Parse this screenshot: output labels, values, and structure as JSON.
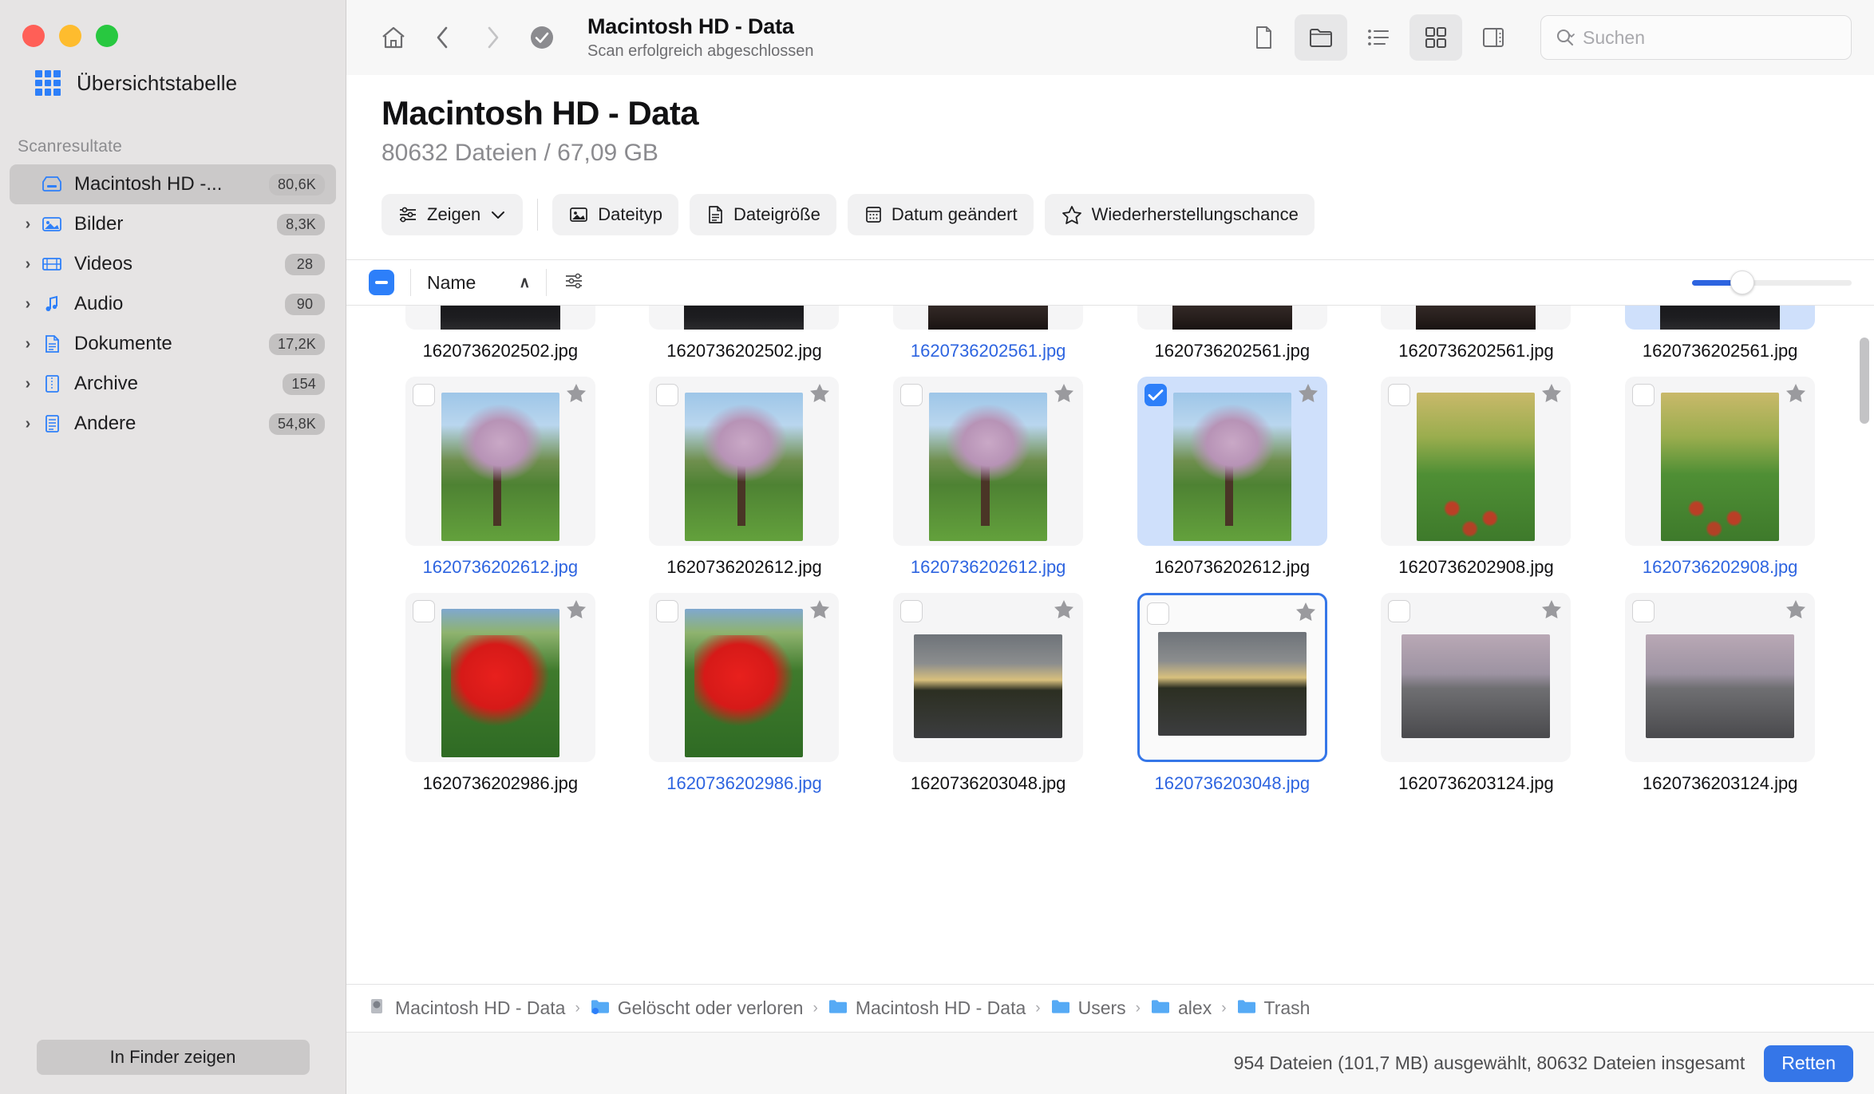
{
  "window": {
    "traffic_lights": [
      "close",
      "minimize",
      "zoom"
    ]
  },
  "sidebar": {
    "overview_label": "Übersichtstabelle",
    "section_title": "Scanresultate",
    "items": [
      {
        "label": "Macintosh HD -...",
        "badge": "80,6K",
        "icon": "drive-icon",
        "expandable": false,
        "active": true
      },
      {
        "label": "Bilder",
        "badge": "8,3K",
        "icon": "image-icon",
        "expandable": true,
        "active": false
      },
      {
        "label": "Videos",
        "badge": "28",
        "icon": "video-icon",
        "expandable": true,
        "active": false
      },
      {
        "label": "Audio",
        "badge": "90",
        "icon": "audio-icon",
        "expandable": true,
        "active": false
      },
      {
        "label": "Dokumente",
        "badge": "17,2K",
        "icon": "document-icon",
        "expandable": true,
        "active": false
      },
      {
        "label": "Archive",
        "badge": "154",
        "icon": "archive-icon",
        "expandable": true,
        "active": false
      },
      {
        "label": "Andere",
        "badge": "54,8K",
        "icon": "other-icon",
        "expandable": true,
        "active": false
      }
    ],
    "finder_button": "In Finder zeigen"
  },
  "toolbar": {
    "home_icon": "home-icon",
    "back_icon": "chevron-left-icon",
    "forward_icon": "chevron-right-icon",
    "status_icon": "check-circle-icon",
    "title": "Macintosh HD - Data",
    "subtitle": "Scan erfolgreich abgeschlossen",
    "view_buttons": [
      {
        "name": "file-view-icon",
        "active": false
      },
      {
        "name": "folder-view-icon",
        "active": true
      },
      {
        "name": "list-view-icon",
        "active": false
      },
      {
        "name": "grid-view-icon",
        "active": true
      },
      {
        "name": "preview-pane-icon",
        "active": false
      }
    ],
    "search_placeholder": "Suchen",
    "search_value": ""
  },
  "page": {
    "title": "Macintosh HD - Data",
    "subtitle": "80632 Dateien / 67,09 GB"
  },
  "filters": [
    {
      "label": "Zeigen",
      "icon": "sliders-icon",
      "chevron": true
    },
    {
      "label": "Dateityp",
      "icon": "image-icon",
      "chevron": false
    },
    {
      "label": "Dateigröße",
      "icon": "document-icon",
      "chevron": false
    },
    {
      "label": "Datum geändert",
      "icon": "calendar-icon",
      "chevron": false
    },
    {
      "label": "Wiederherstellungschance",
      "icon": "star-icon",
      "chevron": false
    }
  ],
  "list_header": {
    "master_checkbox_state": "indeterminate",
    "column_name": "Name",
    "sort_direction": "ascending",
    "sort_glyph": "∧",
    "options_icon": "sliders-icon",
    "zoom_slider_value": 24
  },
  "grid": {
    "rows": [
      {
        "clipped": true,
        "cells": [
          {
            "filename": "1620736202502.jpg",
            "photo": "p-dark",
            "checked": false,
            "selected": false,
            "focused": false,
            "blue_label": false,
            "starred": true
          },
          {
            "filename": "1620736202502.jpg",
            "photo": "p-dark",
            "checked": false,
            "selected": false,
            "focused": false,
            "blue_label": false,
            "starred": true
          },
          {
            "filename": "1620736202561.jpg",
            "photo": "p-dark2",
            "checked": false,
            "selected": false,
            "focused": false,
            "blue_label": true,
            "starred": true
          },
          {
            "filename": "1620736202561.jpg",
            "photo": "p-dark2",
            "checked": false,
            "selected": false,
            "focused": false,
            "blue_label": false,
            "starred": true
          },
          {
            "filename": "1620736202561.jpg",
            "photo": "p-dark2",
            "checked": false,
            "selected": false,
            "focused": false,
            "blue_label": false,
            "starred": true
          },
          {
            "filename": "1620736202561.jpg",
            "photo": "p-dark",
            "checked": false,
            "selected": true,
            "focused": false,
            "blue_label": false,
            "starred": true
          }
        ]
      },
      {
        "clipped": false,
        "cells": [
          {
            "filename": "1620736202612.jpg",
            "photo": "p-blossom",
            "checked": false,
            "selected": false,
            "focused": false,
            "blue_label": true,
            "starred": true
          },
          {
            "filename": "1620736202612.jpg",
            "photo": "p-blossom",
            "checked": false,
            "selected": false,
            "focused": false,
            "blue_label": false,
            "starred": true
          },
          {
            "filename": "1620736202612.jpg",
            "photo": "p-blossom",
            "checked": false,
            "selected": false,
            "focused": false,
            "blue_label": true,
            "starred": true
          },
          {
            "filename": "1620736202612.jpg",
            "photo": "p-blossom",
            "checked": true,
            "selected": true,
            "focused": false,
            "blue_label": false,
            "starred": true
          },
          {
            "filename": "1620736202908.jpg",
            "photo": "p-field",
            "checked": false,
            "selected": false,
            "focused": false,
            "blue_label": false,
            "starred": true
          },
          {
            "filename": "1620736202908.jpg",
            "photo": "p-field",
            "checked": false,
            "selected": false,
            "focused": false,
            "blue_label": true,
            "starred": true
          }
        ]
      },
      {
        "clipped": false,
        "cells": [
          {
            "filename": "1620736202986.jpg",
            "photo": "p-tulip",
            "checked": false,
            "selected": false,
            "focused": false,
            "blue_label": false,
            "starred": true
          },
          {
            "filename": "1620736202986.jpg",
            "photo": "p-tulip",
            "checked": false,
            "selected": false,
            "focused": false,
            "blue_label": true,
            "starred": true
          },
          {
            "filename": "1620736203048.jpg",
            "photo": "p-dusk",
            "checked": false,
            "selected": false,
            "focused": false,
            "blue_label": false,
            "starred": true
          },
          {
            "filename": "1620736203048.jpg",
            "photo": "p-dusk",
            "checked": false,
            "selected": false,
            "focused": true,
            "blue_label": true,
            "starred": true
          },
          {
            "filename": "1620736203124.jpg",
            "photo": "p-road",
            "checked": false,
            "selected": false,
            "focused": false,
            "blue_label": false,
            "starred": true
          },
          {
            "filename": "1620736203124.jpg",
            "photo": "p-road",
            "checked": false,
            "selected": false,
            "focused": false,
            "blue_label": false,
            "starred": true
          }
        ]
      }
    ]
  },
  "breadcrumb": [
    {
      "label": "Macintosh HD - Data",
      "icon": "drive-icon"
    },
    {
      "label": "Gelöscht oder verloren",
      "icon": "folder-deleted-icon"
    },
    {
      "label": "Macintosh HD - Data",
      "icon": "folder-icon"
    },
    {
      "label": "Users",
      "icon": "folder-icon"
    },
    {
      "label": "alex",
      "icon": "folder-icon"
    },
    {
      "label": "Trash",
      "icon": "folder-icon"
    }
  ],
  "breadcrumb_separator": "›",
  "status": {
    "text": "954 Dateien (101,7 MB) ausgewählt, 80632 Dateien insgesamt",
    "button": "Retten"
  },
  "colors": {
    "accent": "#2d7ff9",
    "accent_dark": "#3576e8",
    "selection_bg": "#cfe0fb",
    "sidebar_bg": "#e6e4e4",
    "toolbar_bg": "#f7f7f7"
  }
}
